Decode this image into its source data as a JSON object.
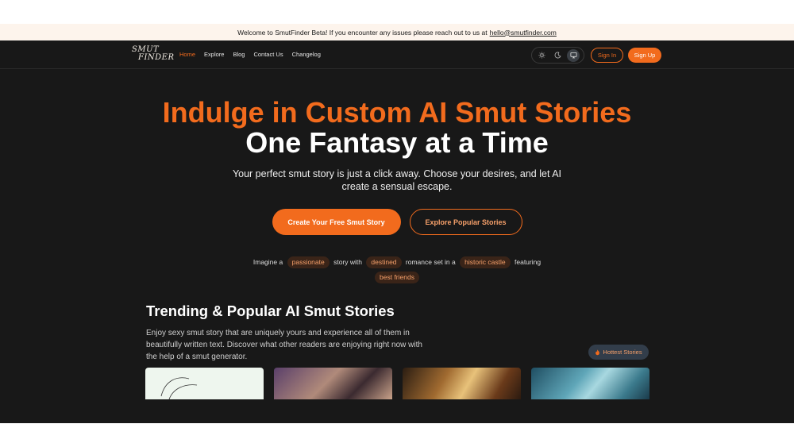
{
  "banner": {
    "text": "Welcome to SmutFinder Beta! If you encounter any issues please reach out to us at",
    "email": "hello@smutfinder.com"
  },
  "nav": {
    "logo_line1": "SMUT",
    "logo_line2": "FINDER",
    "links": [
      "Home",
      "Explore",
      "Blog",
      "Contact Us",
      "Changelog"
    ],
    "active_link": "Home",
    "theme_icons": [
      "sun-icon",
      "moon-icon",
      "monitor-icon"
    ],
    "selected_theme": "monitor-icon",
    "signin_label": "Sign In",
    "signup_label": "Sign Up"
  },
  "hero": {
    "title_line1": "Indulge in Custom AI Smut Stories",
    "title_line2": "One Fantasy at a Time",
    "subtitle": "Your perfect smut story is just a click away. Choose your desires, and let AI create a sensual escape.",
    "cta_primary": "Create Your Free Smut Story",
    "cta_secondary": "Explore Popular Stories",
    "prompt": {
      "t1": "Imagine a",
      "c1": "passionate",
      "t2": "story with",
      "c2": "destined",
      "t3": "romance set in a",
      "c3": "historic castle",
      "t4": "featuring",
      "c4": "best friends"
    }
  },
  "trending": {
    "title": "Trending & Popular AI Smut Stories",
    "description": "Enjoy sexy smut story that are uniquely yours and experience all of them in beautifully written text. Discover what other readers are enjoying right now with the help of a smut generator.",
    "badge_label": "Hottest Stories",
    "badge_icon": "flame-icon"
  },
  "colors": {
    "accent": "#f26b1d",
    "background": "#181818",
    "banner_bg": "#fdf4ec"
  }
}
